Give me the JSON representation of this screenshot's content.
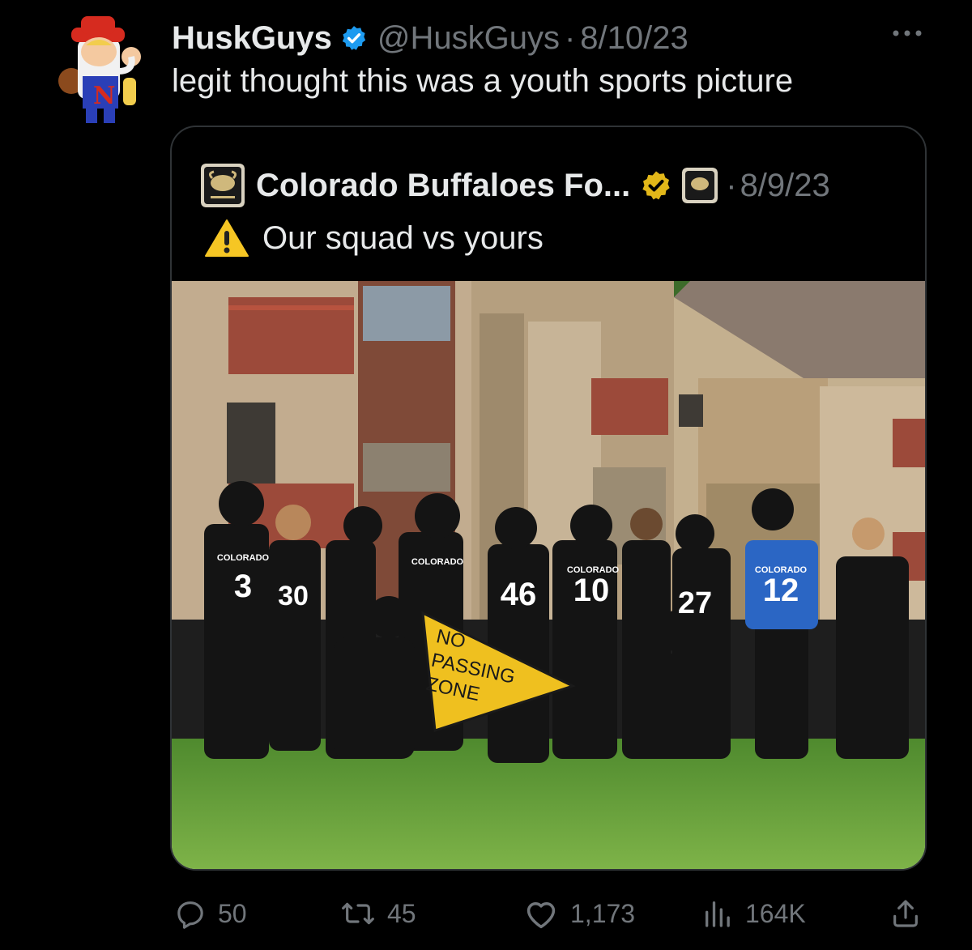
{
  "tweet": {
    "author_name": "HuskGuys",
    "handle": "@HuskGuys",
    "separator": "·",
    "date": "8/10/23",
    "text": "legit thought this was a youth sports picture"
  },
  "quoted_tweet": {
    "author_name": "Colorado Buffaloes Fo...",
    "separator": "·",
    "date": "8/9/23",
    "text": "Our squad vs yours",
    "emoji": "warning-icon",
    "photo": {
      "jersey_numbers": [
        "3",
        "30",
        "46",
        "10",
        "27",
        "12"
      ],
      "jersey_text": "COLORADO",
      "sign_text": [
        "NO",
        "PASSING",
        "ZONE"
      ]
    }
  },
  "actions": {
    "replies": "50",
    "reposts": "45",
    "likes": "1,173",
    "views": "164K"
  },
  "colors": {
    "background": "#000000",
    "text_primary": "#e7e9ea",
    "text_secondary": "#71767b",
    "verified_blue": "#1d9bf0",
    "verified_gold": "#e2b719",
    "border": "#2f3336"
  }
}
